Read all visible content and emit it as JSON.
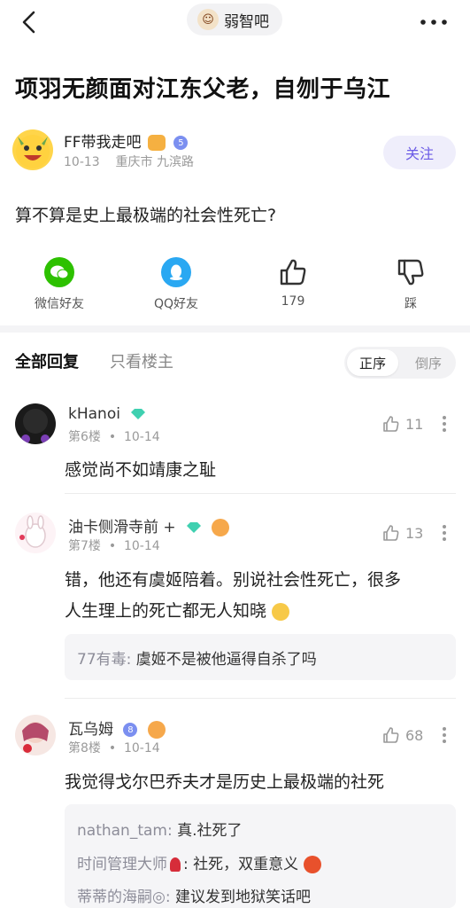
{
  "header": {
    "forum_name": "弱智吧"
  },
  "post": {
    "title": "项羽无颜面对江东父老，自刎于乌江",
    "author": {
      "name": "FF带我走吧",
      "level": "5",
      "date": "10-13",
      "location": "重庆市 九滨路"
    },
    "follow_label": "关注",
    "body": "算不算是史上最极端的社会性死亡?"
  },
  "actions": [
    {
      "label": "微信好友",
      "icon": "wechat-icon",
      "color": "#2dc100"
    },
    {
      "label": "QQ好友",
      "icon": "qq-icon",
      "color": "#2aa8f2"
    },
    {
      "label": "179",
      "icon": "thumbs-up-icon"
    },
    {
      "label": "踩",
      "icon": "thumbs-down-icon"
    }
  ],
  "reply_tabs": {
    "all": "全部回复",
    "op_only": "只看楼主",
    "sort_asc": "正序",
    "sort_desc": "倒序"
  },
  "comments": [
    {
      "name": "kHanoi",
      "floor": "第6楼",
      "date": "10-14",
      "likes": "11",
      "text": "感觉尚不如靖康之耻"
    },
    {
      "name": "油卡侧滑寺前 +",
      "floor": "第7楼",
      "date": "10-14",
      "likes": "13",
      "text_line1": "错，他还有虞姬陪着。别说社会性死亡，很多",
      "text_line2": "人生理上的死亡都无人知晓",
      "sub_replies": [
        {
          "user": "77有毒:",
          "text": "虞姬不是被他逼得自杀了吗"
        }
      ]
    },
    {
      "name": "瓦乌姆",
      "level": "8",
      "floor": "第8楼",
      "date": "10-14",
      "likes": "68",
      "text": "我觉得戈尔巴乔夫才是历史上最极端的社死",
      "sub_replies": [
        {
          "user": "nathan_tam:",
          "text": "真.社死了"
        },
        {
          "user": "时间管理大师",
          "text": ": 社死，双重意义"
        },
        {
          "user": "蒂蒂的海嗣◎:",
          "text": "建议发到地狱笑话吧"
        }
      ]
    }
  ],
  "colors": {
    "accent": "#6b5be6",
    "follow_bg": "#efeefb",
    "muted": "#9a9a9a",
    "diamond": "#3fd0b0",
    "level_badge": "#7b8ff0"
  }
}
